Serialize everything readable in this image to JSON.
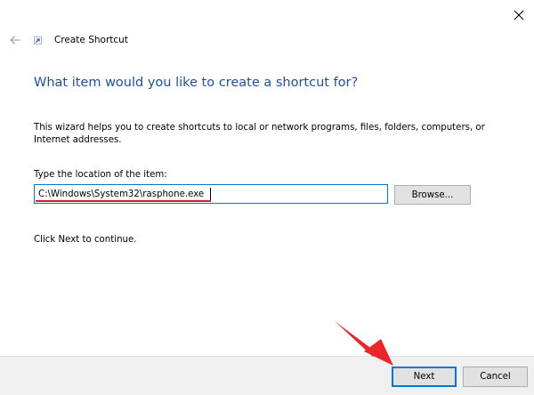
{
  "window": {
    "title": "Create Shortcut",
    "close_icon": "close-icon",
    "back_icon": "back-arrow-icon",
    "app_icon": "shortcut-icon"
  },
  "main": {
    "heading": "What item would you like to create a shortcut for?",
    "description": "This wizard helps you to create shortcuts to local or network programs, files, folders, computers, or Internet addresses.",
    "location_label": "Type the location of the item:",
    "location_value": "C:\\Windows\\System32\\rasphone.exe",
    "browse_label": "Browse...",
    "continue_text": "Click Next to continue."
  },
  "footer": {
    "next_label": "Next",
    "cancel_label": "Cancel"
  },
  "annotations": {
    "arrow_color": "#e8262b",
    "underline_color": "#d2202a"
  },
  "colors": {
    "heading": "#1e4f9c",
    "accent": "#0078d7",
    "footer_bg": "#f0f0f0",
    "button_bg": "#e1e1e1"
  }
}
